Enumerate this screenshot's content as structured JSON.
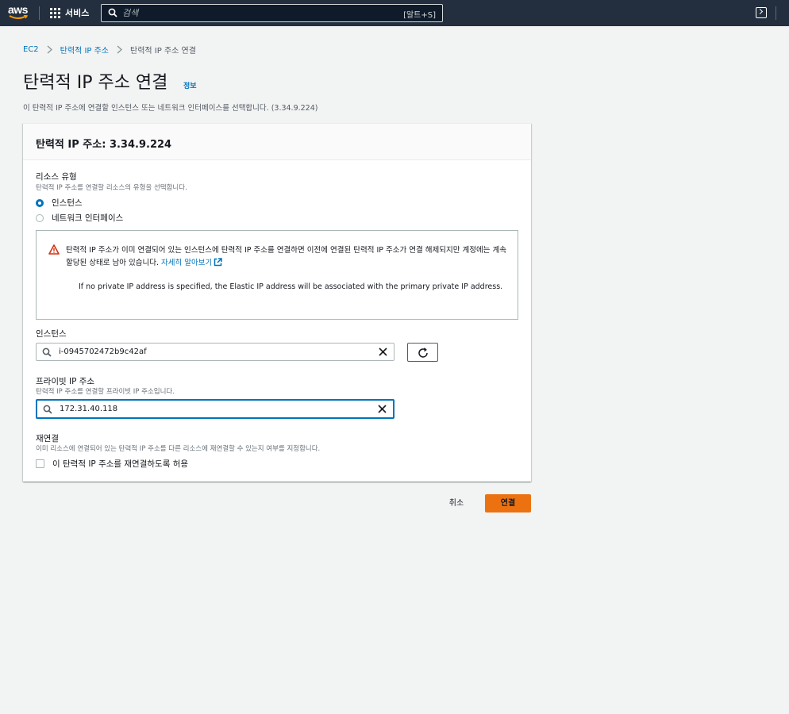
{
  "topbar": {
    "logo_text": "aws",
    "services_label": "서비스",
    "search_placeholder": "검색",
    "search_shortcut": "[알트+S]"
  },
  "breadcrumb": {
    "items": [
      "EC2",
      "탄력적 IP 주소"
    ],
    "current": "탄력적 IP 주소 연결"
  },
  "page": {
    "title": "탄력적 IP 주소 연결",
    "info_link": "정보",
    "description": "이 탄력적 IP 주소에 연결할 인스턴스 또는 네트워크 인터페이스를 선택합니다. (3.34.9.224)"
  },
  "panel": {
    "title": "탄력적 IP 주소: 3.34.9.224",
    "resource_type": {
      "label": "리소스 유형",
      "description": "탄력적 IP 주소를 연결할 리소스의 유형을 선택합니다.",
      "options": [
        "인스턴스",
        "네트워크 인터페이스"
      ],
      "selected": "인스턴스"
    },
    "alert": {
      "text": "탄력적 IP 주소가 이미 연결되어 있는 인스턴스에 탄력적 IP 주소를 연결하면 이전에 연결된 탄력적 IP 주소가 연결 해제되지만 계정에는 계속 할당된 상태로 남아 있습니다.",
      "link": "자세히 알아보기",
      "note": "If no private IP address is specified, the Elastic IP address will be associated with the primary private IP address."
    },
    "instance": {
      "label": "인스턴스",
      "value": "i-0945702472b9c42af"
    },
    "private_ip": {
      "label": "프라이빗 IP 주소",
      "description": "탄력적 IP 주소를 연결할 프라이빗 IP 주소입니다.",
      "value": "172.31.40.118"
    },
    "reassociation": {
      "label": "재연결",
      "description": "이미 리소스에 연결되어 있는 탄력적 IP 주소를 다른 리소스에 재연결할 수 있는지 여부를 지정합니다.",
      "checkbox_label": "이 탄력적 IP 주소를 재연결하도록 허용",
      "checked": false
    }
  },
  "actions": {
    "cancel": "취소",
    "submit": "연결"
  },
  "colors": {
    "topbar": "#232f3e",
    "link": "#0073bb",
    "primary_button": "#ec7211",
    "warning": "#d13212"
  }
}
